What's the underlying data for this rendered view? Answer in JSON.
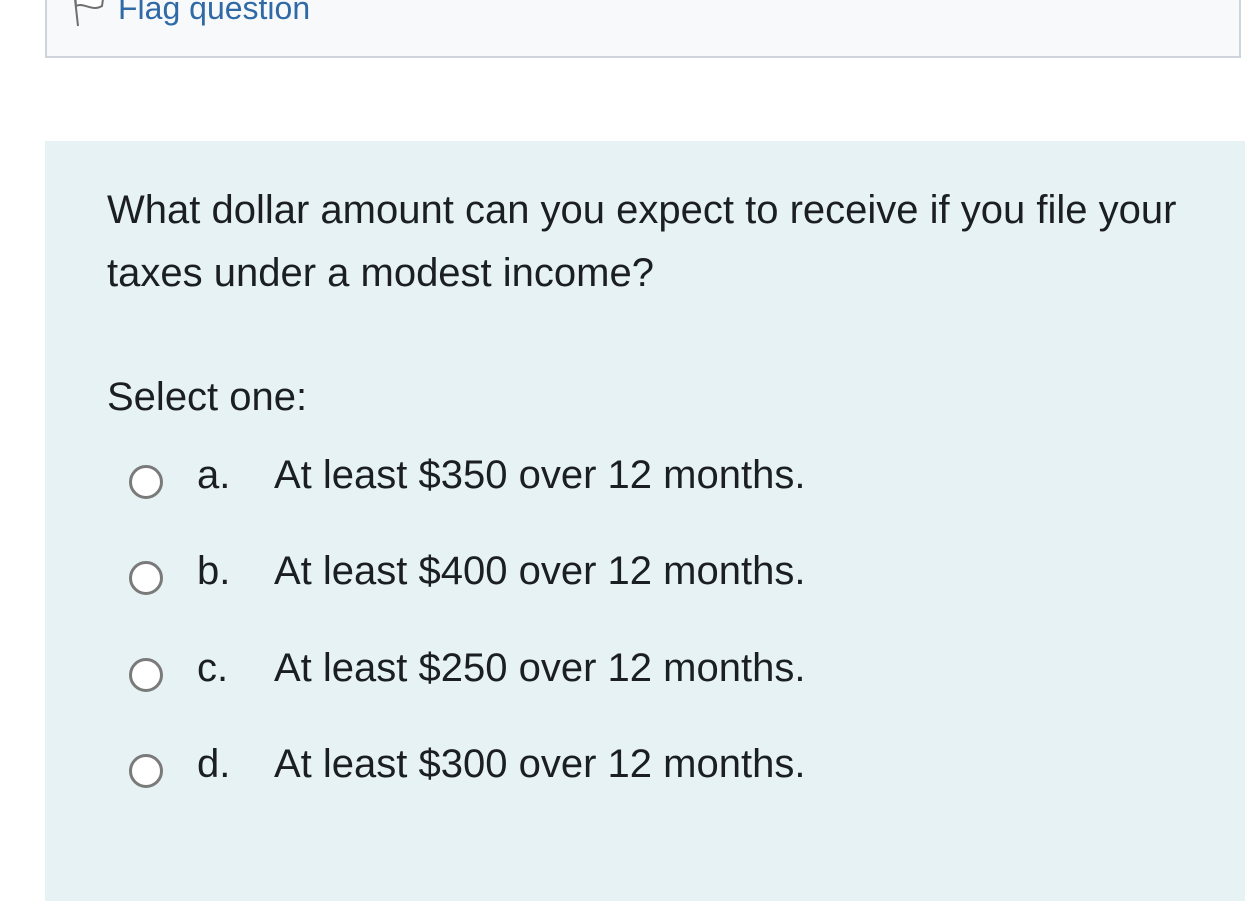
{
  "flag": {
    "label": "Flag question"
  },
  "question": {
    "text": "What dollar amount can you expect to receive if you file your taxes under a modest income?",
    "prompt": "Select one:"
  },
  "answers": [
    {
      "letter": "a.",
      "text": "At least $350 over 12 months.",
      "selected": false
    },
    {
      "letter": "b.",
      "text": "At least $400 over 12 months.",
      "selected": false
    },
    {
      "letter": "c.",
      "text": "At least $250 over 12 months.",
      "selected": false
    },
    {
      "letter": "d.",
      "text": "At least $300 over 12 months.",
      "selected": false
    }
  ],
  "colors": {
    "link": "#2f6aa6",
    "question_bg": "#e7f2f5",
    "info_bg": "#f8f9fb",
    "text": "#1b1f24"
  }
}
